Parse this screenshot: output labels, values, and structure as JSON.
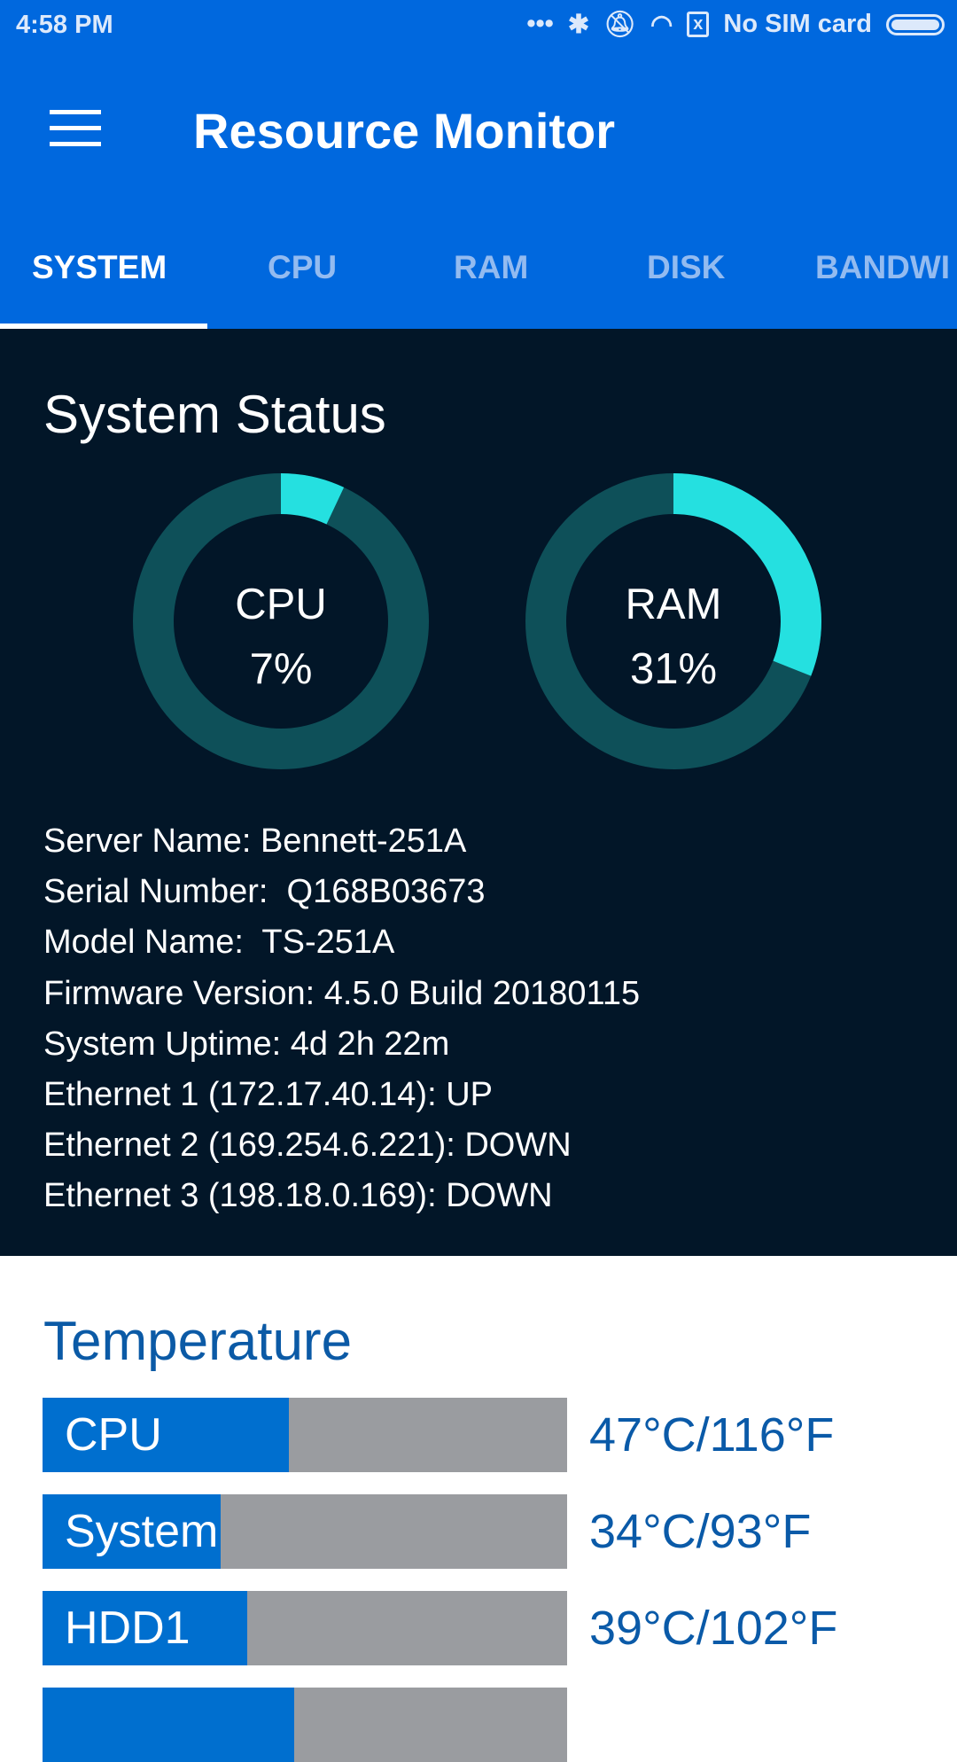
{
  "status_bar": {
    "time": "4:58 PM",
    "carrier": "No SIM card",
    "icons": [
      "more-dots-icon",
      "bluetooth-icon",
      "vibrate-off-icon",
      "wifi-icon",
      "sim-off-icon",
      "battery-icon"
    ]
  },
  "app_bar": {
    "title": "Resource Monitor",
    "menu_icon": "hamburger-icon"
  },
  "tabs": [
    {
      "label": "SYSTEM",
      "active": true
    },
    {
      "label": "CPU"
    },
    {
      "label": "RAM"
    },
    {
      "label": "DISK"
    },
    {
      "label": "BANDWI"
    }
  ],
  "system_status": {
    "title": "System Status",
    "gauges": [
      {
        "label": "CPU",
        "value_text": "7%",
        "percent": 7
      },
      {
        "label": "RAM",
        "value_text": "31%",
        "percent": 31
      }
    ],
    "info": [
      "Server Name: Bennett-251A",
      "Serial Number:  Q168B03673",
      "Model Name:  TS-251A",
      "Firmware Version: 4.5.0 Build 20180115",
      "System Uptime: 4d 2h 22m",
      "Ethernet 1 (172.17.40.14): UP",
      "Ethernet 2 (169.254.6.221): DOWN",
      "Ethernet 3 (198.18.0.169): DOWN"
    ]
  },
  "temperature": {
    "title": "Temperature",
    "rows": [
      {
        "label": "CPU",
        "value": "47°C/116°F",
        "level": 0.47
      },
      {
        "label": "System",
        "value": "34°C/93°F",
        "level": 0.34
      },
      {
        "label": "HDD1",
        "value": "39°C/102°F",
        "level": 0.39
      },
      {
        "level": 0.48
      }
    ]
  },
  "colors": {
    "primary": "#0068de",
    "dark_bg": "#021628",
    "gauge_track": "#0e5059",
    "gauge_fill": "#25e0e0",
    "bar_fill": "#006fcf",
    "bar_track": "#9a9ca0"
  }
}
